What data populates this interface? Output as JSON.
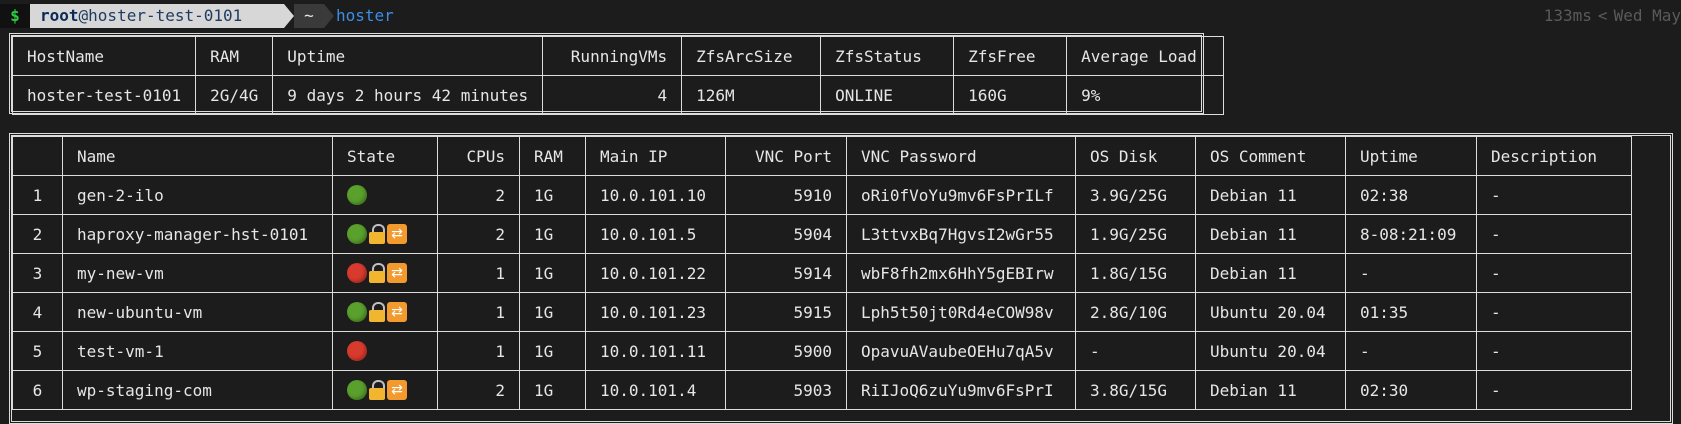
{
  "prompt": {
    "dollar": "$",
    "user": "root",
    "host": "@hoster-test-0101",
    "dir": "~",
    "command": "hoster",
    "duration": "133ms",
    "chevron": "<",
    "datetime": "Wed May"
  },
  "host_table": {
    "headers": [
      "HostName",
      "RAM",
      "Uptime",
      "RunningVMs",
      "ZfsArcSize",
      "ZfsStatus",
      "ZfsFree",
      "Average Load"
    ],
    "row": [
      "hoster-test-0101",
      "2G/4G",
      "9 days 2 hours 42 minutes",
      "4",
      "126M",
      "ONLINE",
      "160G",
      "9%"
    ]
  },
  "vm_table": {
    "headers": [
      "",
      "Name",
      "State",
      "CPUs",
      "RAM",
      "Main IP",
      "VNC Port",
      "VNC Password",
      "OS Disk",
      "OS Comment",
      "Uptime",
      "Description"
    ],
    "rows": [
      {
        "idx": "1",
        "name": "gen-2-ilo",
        "state": {
          "status": "green",
          "locked": false,
          "repeat": false
        },
        "cpus": "2",
        "ram": "1G",
        "ip": "10.0.101.10",
        "vnc_port": "5910",
        "vnc_password": "oRi0fVoYu9mv6FsPrILf",
        "os_disk": "3.9G/25G",
        "os_comment": "Debian 11",
        "uptime": "02:38",
        "description": "-"
      },
      {
        "idx": "2",
        "name": "haproxy-manager-hst-0101",
        "state": {
          "status": "green",
          "locked": true,
          "repeat": true
        },
        "cpus": "2",
        "ram": "1G",
        "ip": "10.0.101.5",
        "vnc_port": "5904",
        "vnc_password": "L3ttvxBq7HgvsI2wGr55",
        "os_disk": "1.9G/25G",
        "os_comment": "Debian 11",
        "uptime": "8-08:21:09",
        "description": "-"
      },
      {
        "idx": "3",
        "name": "my-new-vm",
        "state": {
          "status": "red",
          "locked": true,
          "repeat": true
        },
        "cpus": "1",
        "ram": "1G",
        "ip": "10.0.101.22",
        "vnc_port": "5914",
        "vnc_password": "wbF8fh2mx6HhY5gEBIrw",
        "os_disk": "1.8G/15G",
        "os_comment": "Debian 11",
        "uptime": "-",
        "description": "-"
      },
      {
        "idx": "4",
        "name": "new-ubuntu-vm",
        "state": {
          "status": "green",
          "locked": true,
          "repeat": true
        },
        "cpus": "1",
        "ram": "1G",
        "ip": "10.0.101.23",
        "vnc_port": "5915",
        "vnc_password": "Lph5t50jt0Rd4eCOW98v",
        "os_disk": "2.8G/10G",
        "os_comment": "Ubuntu 20.04",
        "uptime": "01:35",
        "description": "-"
      },
      {
        "idx": "5",
        "name": "test-vm-1",
        "state": {
          "status": "red",
          "locked": false,
          "repeat": false
        },
        "cpus": "1",
        "ram": "1G",
        "ip": "10.0.101.11",
        "vnc_port": "5900",
        "vnc_password": "OpavuAVaubeOEHu7qA5v",
        "os_disk": "-",
        "os_comment": "Ubuntu 20.04",
        "uptime": "-",
        "description": "-"
      },
      {
        "idx": "6",
        "name": "wp-staging-com",
        "state": {
          "status": "green",
          "locked": true,
          "repeat": true
        },
        "cpus": "2",
        "ram": "1G",
        "ip": "10.0.101.4",
        "vnc_port": "5903",
        "vnc_password": "RiIJoQ6zuYu9mv6FsPrI",
        "os_disk": "3.8G/15G",
        "os_comment": "Debian 11",
        "uptime": "02:30",
        "description": "-"
      }
    ]
  },
  "colors": {
    "background": "#1c1c1c",
    "green_status": "#5aa02c",
    "red_status": "#d83a2e",
    "command": "#3d8ee6"
  }
}
